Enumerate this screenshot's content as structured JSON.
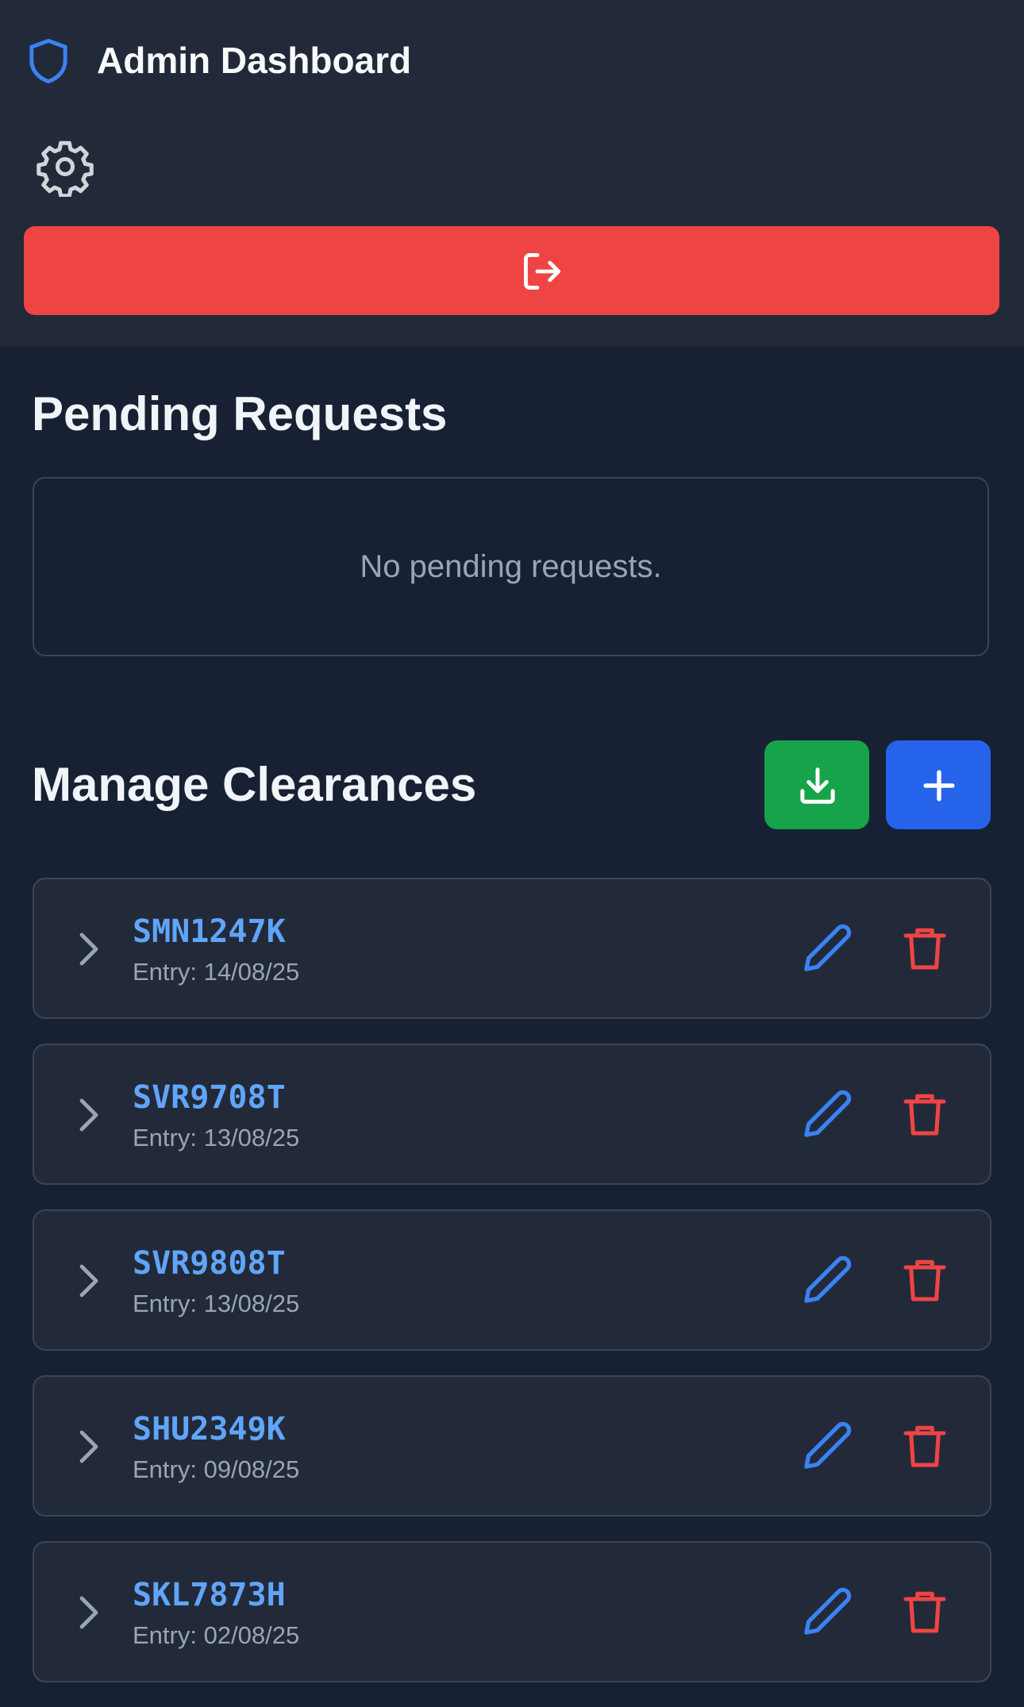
{
  "header": {
    "title": "Admin Dashboard",
    "logo_icon": "shield-icon",
    "settings_icon": "gear-icon",
    "logout_icon": "logout-icon"
  },
  "pending": {
    "title": "Pending Requests",
    "empty_text": "No pending requests."
  },
  "clearances": {
    "title": "Manage Clearances",
    "download_icon": "download-icon",
    "add_icon": "plus-icon",
    "items": [
      {
        "id": "SMN1247K",
        "entry": "Entry: 14/08/25"
      },
      {
        "id": "SVR9708T",
        "entry": "Entry: 13/08/25"
      },
      {
        "id": "SVR9808T",
        "entry": "Entry: 13/08/25"
      },
      {
        "id": "SHU2349K",
        "entry": "Entry: 09/08/25"
      },
      {
        "id": "SKL7873H",
        "entry": "Entry: 02/08/25"
      }
    ]
  },
  "colors": {
    "background": "#172133",
    "panel": "#222a3a",
    "danger": "#ef4444",
    "success": "#16a34a",
    "primary": "#2563eb",
    "accent_text": "#60a5fa"
  }
}
